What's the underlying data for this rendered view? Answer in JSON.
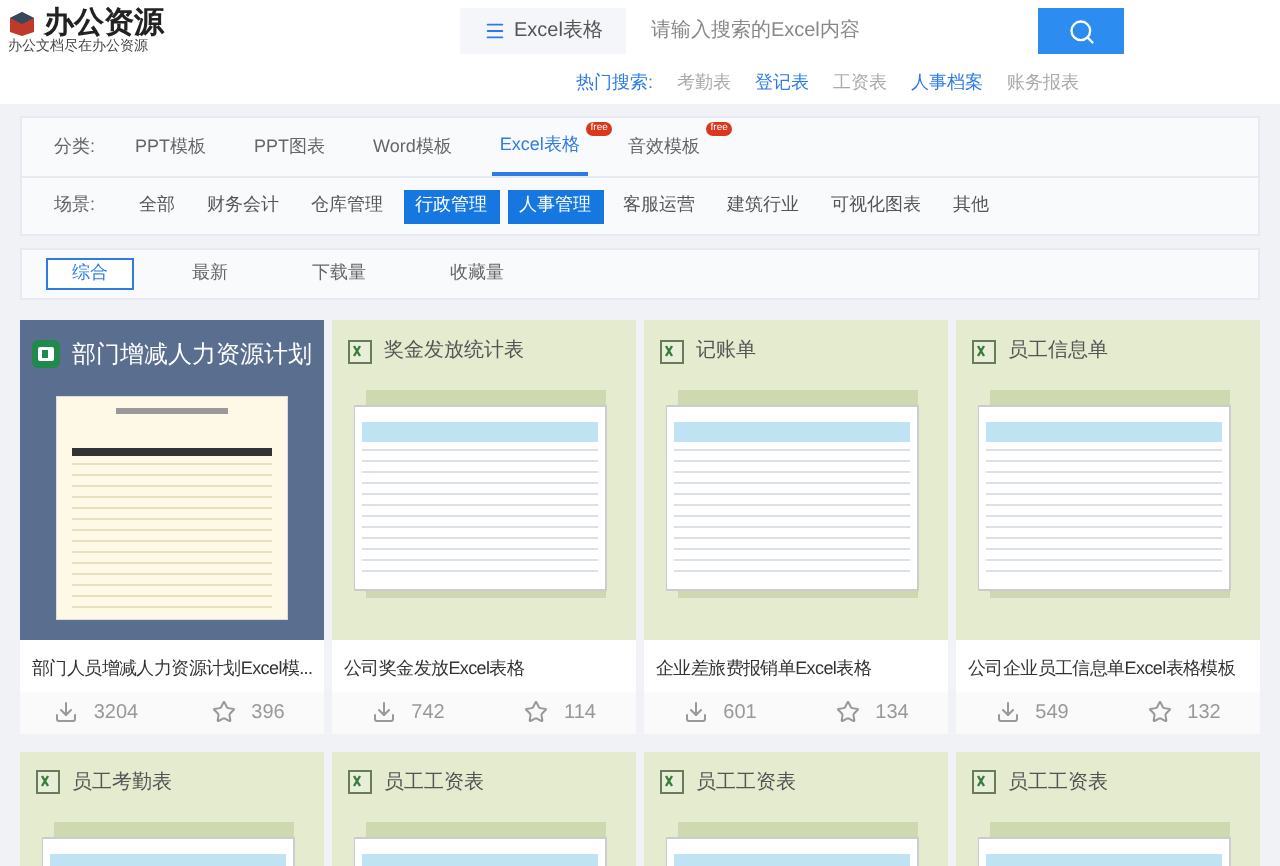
{
  "logo": {
    "name": "办公资源",
    "tagline": "办公文档尽在办公资源"
  },
  "search": {
    "scope": "Excel表格",
    "placeholder": "请输入搜索的Excel内容"
  },
  "hot_search": {
    "label": "热门搜索:",
    "items": [
      {
        "text": "考勤表",
        "highlighted": false
      },
      {
        "text": "登记表",
        "highlighted": true
      },
      {
        "text": "工资表",
        "highlighted": false
      },
      {
        "text": "人事档案",
        "highlighted": true
      },
      {
        "text": "账务报表",
        "highlighted": false
      }
    ]
  },
  "category": {
    "label": "分类:",
    "tabs": [
      {
        "label": "PPT模板",
        "selected": false
      },
      {
        "label": "PPT图表",
        "selected": false
      },
      {
        "label": "Word模板",
        "selected": false
      },
      {
        "label": "Excel表格",
        "selected": true,
        "badge": "free"
      },
      {
        "label": "音效模板",
        "selected": false,
        "badge": "free"
      }
    ]
  },
  "scene": {
    "label": "场景:",
    "items": [
      {
        "label": "全部",
        "selected": false
      },
      {
        "label": "财务会计",
        "selected": false
      },
      {
        "label": "仓库管理",
        "selected": false
      },
      {
        "label": "行政管理",
        "selected": true
      },
      {
        "label": "人事管理",
        "selected": true
      },
      {
        "label": "客服运营",
        "selected": false
      },
      {
        "label": "建筑行业",
        "selected": false
      },
      {
        "label": "可视化图表",
        "selected": false
      },
      {
        "label": "其他",
        "selected": false
      }
    ]
  },
  "sort": [
    {
      "label": "综合",
      "selected": true
    },
    {
      "label": "最新",
      "selected": false
    },
    {
      "label": "下载量",
      "selected": false
    },
    {
      "label": "收藏量",
      "selected": false
    }
  ],
  "cards": [
    {
      "kind": "dark",
      "thumb_title": "部门增减人力资源计划",
      "title": "部门人员增减人力资源计划Excel模...",
      "downloads": "3204",
      "favorites": "396"
    },
    {
      "kind": "light",
      "thumb_title": "奖金发放统计表",
      "title": "公司奖金发放Excel表格",
      "downloads": "742",
      "favorites": "114"
    },
    {
      "kind": "light",
      "thumb_title": "记账单",
      "title": "企业差旅费报销单Excel表格",
      "downloads": "601",
      "favorites": "134"
    },
    {
      "kind": "light",
      "thumb_title": "员工信息单",
      "title": "公司企业员工信息单Excel表格模板",
      "downloads": "549",
      "favorites": "132"
    },
    {
      "kind": "light",
      "thumb_title": "员工考勤表"
    },
    {
      "kind": "light",
      "thumb_title": "员工工资表"
    },
    {
      "kind": "light",
      "thumb_title": "员工工资表"
    },
    {
      "kind": "light",
      "thumb_title": "员工工资表"
    }
  ]
}
